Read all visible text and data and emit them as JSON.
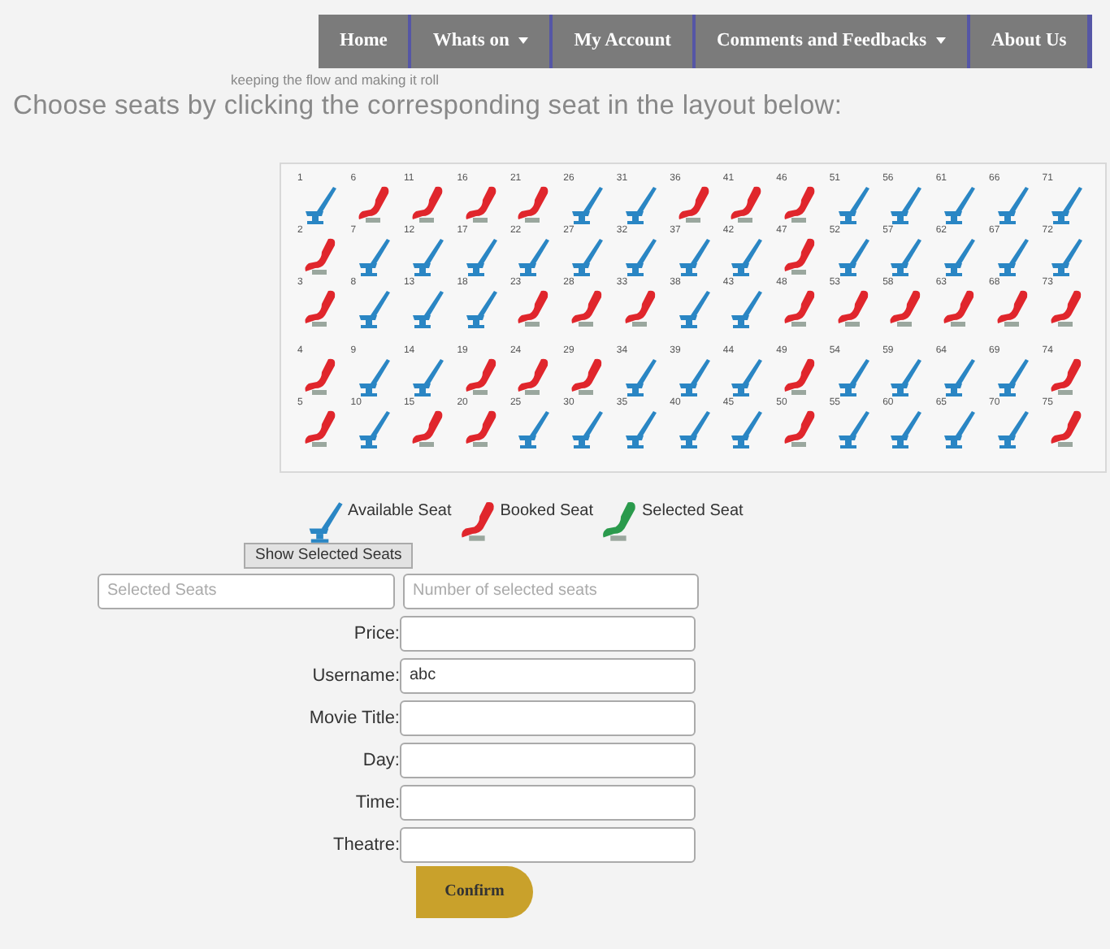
{
  "nav": [
    {
      "label": "Home",
      "dropdown": false
    },
    {
      "label": "Whats on",
      "dropdown": true
    },
    {
      "label": "My Account",
      "dropdown": false
    },
    {
      "label": "Comments and Feedbacks",
      "dropdown": true
    },
    {
      "label": "About Us",
      "dropdown": false
    }
  ],
  "tagline": "keeping the flow and making it roll",
  "heading": "Choose seats by clicking the corresponding seat in the layout below:",
  "sections": [
    {
      "rows": [
        {
          "seats": [
            {
              "number": "1",
              "booked": false
            },
            {
              "number": "6",
              "booked": true
            },
            {
              "number": "11",
              "booked": true
            },
            {
              "number": "16",
              "booked": true
            },
            {
              "number": "21",
              "booked": true
            },
            {
              "number": "26",
              "booked": false
            },
            {
              "number": "31",
              "booked": false
            },
            {
              "number": "36",
              "booked": true
            },
            {
              "number": "41",
              "booked": true
            },
            {
              "number": "46",
              "booked": true
            },
            {
              "number": "51",
              "booked": false
            },
            {
              "number": "56",
              "booked": false
            },
            {
              "number": "61",
              "booked": false
            },
            {
              "number": "66",
              "booked": false
            },
            {
              "number": "71",
              "booked": false
            }
          ]
        },
        {
          "seats": [
            {
              "number": "2",
              "booked": true
            },
            {
              "number": "7",
              "booked": false
            },
            {
              "number": "12",
              "booked": false
            },
            {
              "number": "17",
              "booked": false
            },
            {
              "number": "22",
              "booked": false
            },
            {
              "number": "27",
              "booked": false
            },
            {
              "number": "32",
              "booked": false
            },
            {
              "number": "37",
              "booked": false
            },
            {
              "number": "42",
              "booked": false
            },
            {
              "number": "47",
              "booked": true
            },
            {
              "number": "52",
              "booked": false
            },
            {
              "number": "57",
              "booked": false
            },
            {
              "number": "62",
              "booked": false
            },
            {
              "number": "67",
              "booked": false
            },
            {
              "number": "72",
              "booked": false
            }
          ]
        },
        {
          "seats": [
            {
              "number": "3",
              "booked": true
            },
            {
              "number": "8",
              "booked": false
            },
            {
              "number": "13",
              "booked": false
            },
            {
              "number": "18",
              "booked": false
            },
            {
              "number": "23",
              "booked": true
            },
            {
              "number": "28",
              "booked": true
            },
            {
              "number": "33",
              "booked": true
            },
            {
              "number": "38",
              "booked": false
            },
            {
              "number": "43",
              "booked": false
            },
            {
              "number": "48",
              "booked": true
            },
            {
              "number": "53",
              "booked": true
            },
            {
              "number": "58",
              "booked": true
            },
            {
              "number": "63",
              "booked": true
            },
            {
              "number": "68",
              "booked": true
            },
            {
              "number": "73",
              "booked": true
            }
          ]
        }
      ]
    },
    {
      "rows": [
        {
          "seats": [
            {
              "number": "4",
              "booked": true
            },
            {
              "number": "9",
              "booked": false
            },
            {
              "number": "14",
              "booked": false
            },
            {
              "number": "19",
              "booked": true
            },
            {
              "number": "24",
              "booked": true
            },
            {
              "number": "29",
              "booked": true
            },
            {
              "number": "34",
              "booked": false
            },
            {
              "number": "39",
              "booked": false
            },
            {
              "number": "44",
              "booked": false
            },
            {
              "number": "49",
              "booked": true
            },
            {
              "number": "54",
              "booked": false
            },
            {
              "number": "59",
              "booked": false
            },
            {
              "number": "64",
              "booked": false
            },
            {
              "number": "69",
              "booked": false
            },
            {
              "number": "74",
              "booked": true
            }
          ]
        },
        {
          "seats": [
            {
              "number": "5",
              "booked": true
            },
            {
              "number": "10",
              "booked": false
            },
            {
              "number": "15",
              "booked": true
            },
            {
              "number": "20",
              "booked": true
            },
            {
              "number": "25",
              "booked": false
            },
            {
              "number": "30",
              "booked": false
            },
            {
              "number": "35",
              "booked": false
            },
            {
              "number": "40",
              "booked": false
            },
            {
              "number": "45",
              "booked": false
            },
            {
              "number": "50",
              "booked": true
            },
            {
              "number": "55",
              "booked": false
            },
            {
              "number": "60",
              "booked": false
            },
            {
              "number": "65",
              "booked": false
            },
            {
              "number": "70",
              "booked": false
            },
            {
              "number": "75",
              "booked": true
            }
          ]
        }
      ]
    }
  ],
  "legend": [
    {
      "kind": "available",
      "label": "Available Seat"
    },
    {
      "kind": "booked",
      "label": "Booked Seat"
    },
    {
      "kind": "selected",
      "label": "Selected Seat"
    }
  ],
  "show_button": "Show Selected Seats",
  "selection_fields": [
    {
      "placeholder": "Selected Seats"
    },
    {
      "placeholder": "Number of selected seats"
    }
  ],
  "form": [
    {
      "label": "Price:"
    },
    {
      "label": "Username:",
      "value": "abc"
    },
    {
      "label": "Movie Title:"
    },
    {
      "label": "Day:"
    },
    {
      "label": "Time:"
    },
    {
      "label": "Theatre:"
    }
  ],
  "confirm": "Confirm"
}
